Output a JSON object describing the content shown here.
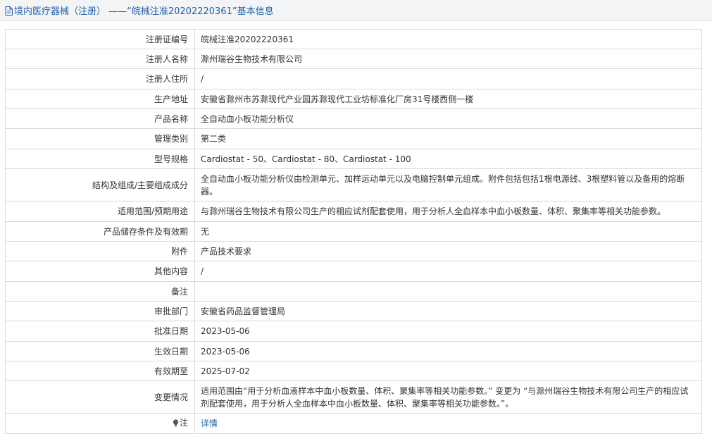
{
  "header": {
    "title": "境内医疗器械（注册） ——“皖械注准20202220361”基本信息",
    "icon": "document-icon"
  },
  "rows": [
    {
      "label": "注册证编号",
      "value": "皖械注准20202220361"
    },
    {
      "label": "注册人名称",
      "value": "滁州瑞谷生物技术有限公司"
    },
    {
      "label": "注册人住所",
      "value": "/"
    },
    {
      "label": "生产地址",
      "value": "安徽省滁州市苏滁现代产业园苏滁现代工业坊标准化厂房31号楼西侧一楼"
    },
    {
      "label": "产品名称",
      "value": "全自动血小板功能分析仪"
    },
    {
      "label": "管理类别",
      "value": "第二类"
    },
    {
      "label": "型号规格",
      "value": "Cardiostat - 50、Cardiostat - 80、Cardiostat - 100"
    },
    {
      "label": "结构及组成/主要组成成分",
      "value": "全自动血小板功能分析仪由检测单元、加样运动单元以及电脑控制单元组成。附件包括包括1根电源线、3根塑料管以及备用的熔断器。"
    },
    {
      "label": "适用范围/预期用途",
      "value": "与滁州瑞谷生物技术有限公司生产的相应试剂配套使用，用于分析人全血样本中血小板数量、体积、聚集率等相关功能参数。"
    },
    {
      "label": "产品储存条件及有效期",
      "value": "无"
    },
    {
      "label": "附件",
      "value": "产品技术要求"
    },
    {
      "label": "其他内容",
      "value": "/"
    },
    {
      "label": "备注",
      "value": ""
    },
    {
      "label": "审批部门",
      "value": "安徽省药品监督管理局"
    },
    {
      "label": "批准日期",
      "value": "2023-05-06"
    },
    {
      "label": "生效日期",
      "value": "2023-05-06"
    },
    {
      "label": "有效期至",
      "value": "2025-07-02"
    },
    {
      "label": "变更情况",
      "value": "适用范围由“用于分析血液样本中血小板数量、体积、聚集率等相关功能参数。” 变更为 “与滁州瑞谷生物技术有限公司生产的相应试剂配套使用，用于分析人全血样本中血小板数量、体积、聚集率等相关功能参数。”。"
    }
  ],
  "note": {
    "label": "注",
    "icon": "lightbulb-icon",
    "link": "详情"
  },
  "colors": {
    "link": "#1f5fa8",
    "border": "#d9d9d9",
    "header_bg": "#f3f4f6"
  }
}
